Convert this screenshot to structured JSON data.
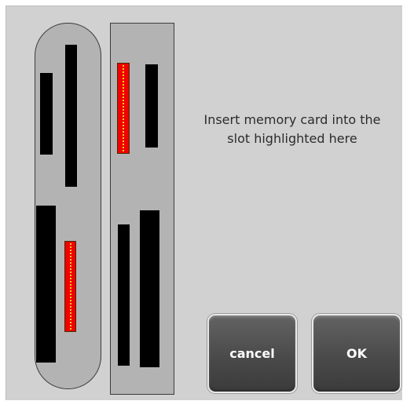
{
  "instruction": {
    "line1": "Insert memory card into the",
    "line2": "slot highlighted here"
  },
  "buttons": {
    "cancel": "cancel",
    "ok": "OK"
  },
  "highlighted_slot": "left-reader-lower-right",
  "colors": {
    "dialog_background": "#d1d1d1",
    "reader_body": "#b3b3b3",
    "slot": "#000000",
    "highlight": "#f00000",
    "highlight_stripe": "#ffd21a",
    "button": "#4a4a4a"
  }
}
